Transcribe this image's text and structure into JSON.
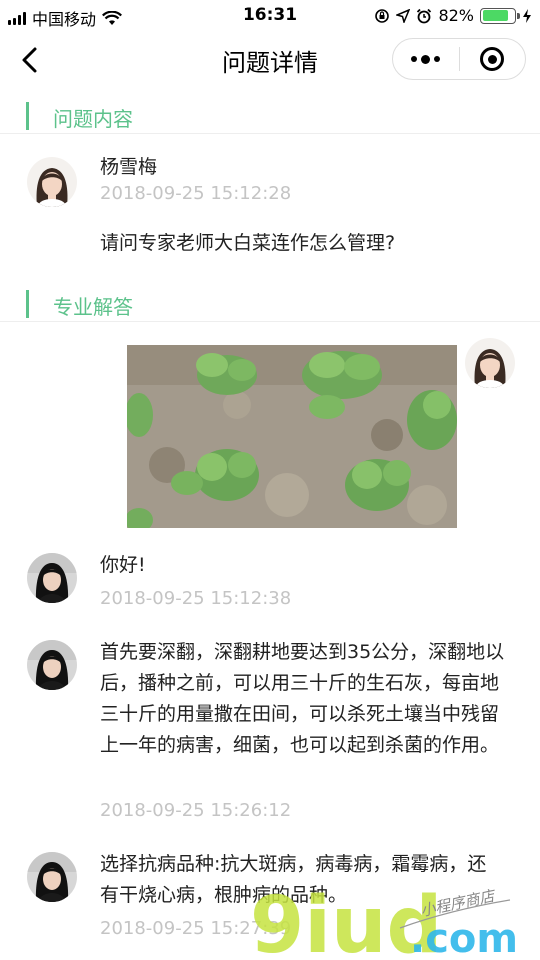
{
  "status_bar": {
    "carrier": "中国移动",
    "time": "16:31",
    "battery": "82%",
    "battery_level": 0.82
  },
  "nav": {
    "title": "问题详情"
  },
  "question_section": {
    "title": "问题内容",
    "author": "杨雪梅",
    "timestamp": "2018-09-25 15:12:28",
    "content": "请问专家老师大白菜连作怎么管理?"
  },
  "answer_section": {
    "title": "专业解答",
    "messages": [
      {
        "text": "你好!",
        "timestamp": "2018-09-25 15:12:38"
      },
      {
        "text": "首先要深翻，深翻耕地要达到35公分，深翻地以后，播种之前，可以用三十斤的生石灰，每亩地三十斤的用量撒在田间，可以杀死土壤当中残留上一年的病害，细菌，也可以起到杀菌的作用。",
        "timestamp": "2018-09-25 15:26:12"
      },
      {
        "text": "选择抗病品种:抗大斑病，病毒病，霜霉病，还有干烧心病，根肿病的品种。",
        "timestamp": "2018-09-25 15:27:39"
      }
    ]
  },
  "watermark": {
    "big": "9iud",
    "domain": ".com",
    "tagline": "小程序商店"
  },
  "colors": {
    "accent": "#5cc28b",
    "timestamp": "#c4c4c4"
  }
}
